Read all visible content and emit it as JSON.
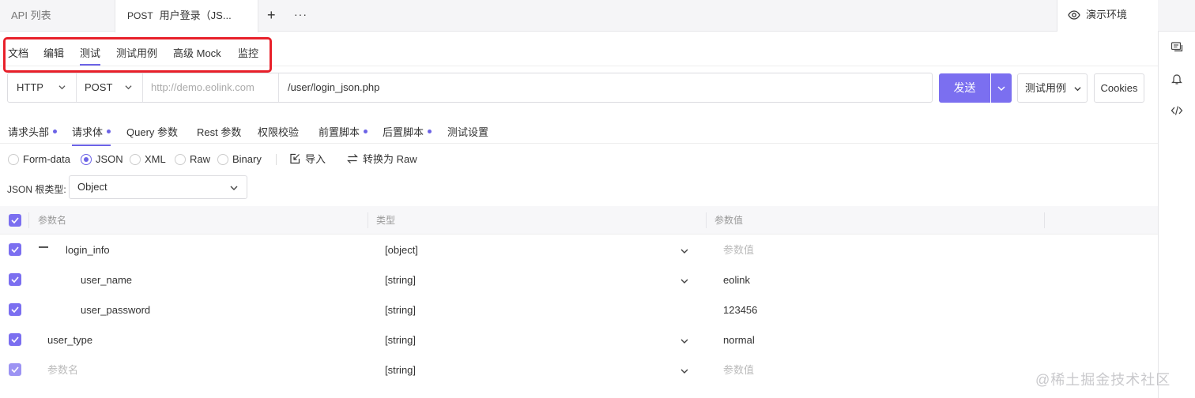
{
  "tabs": {
    "api_list": "API 列表",
    "current_method": "POST",
    "current_title": "用户登录（JS...",
    "add": "+",
    "more": "···"
  },
  "environment": {
    "label": "演示环境"
  },
  "sub_tabs": [
    "文档",
    "编辑",
    "测试",
    "测试用例",
    "高级 Mock",
    "监控"
  ],
  "url_bar": {
    "protocol": "HTTP",
    "method": "POST",
    "host_placeholder": "http://demo.eolink.com",
    "path": "/user/login_json.php"
  },
  "actions": {
    "send": "发送",
    "test_case": "测试用例",
    "cookies": "Cookies"
  },
  "request_tabs": [
    {
      "label": "请求头部",
      "dot": true
    },
    {
      "label": "请求体",
      "dot": true
    },
    {
      "label": "Query 参数",
      "dot": false
    },
    {
      "label": "Rest 参数",
      "dot": false
    },
    {
      "label": "权限校验",
      "dot": false
    },
    {
      "label": "前置脚本",
      "dot": true
    },
    {
      "label": "后置脚本",
      "dot": true
    },
    {
      "label": "测试设置",
      "dot": false
    }
  ],
  "body_formats": {
    "options": [
      "Form-data",
      "JSON",
      "XML",
      "Raw",
      "Binary"
    ],
    "selected": "JSON",
    "import": "导入",
    "convert": "转换为 Raw"
  },
  "json_root": {
    "label": "JSON 根类型:",
    "value": "Object"
  },
  "table": {
    "headers": {
      "name": "参数名",
      "type": "类型",
      "value": "参数值"
    },
    "rows": [
      {
        "name": "login_info",
        "type": "[object]",
        "value": "参数值",
        "value_placeholder": true,
        "level": 0,
        "collapsible": true,
        "dropdown": true
      },
      {
        "name": "user_name",
        "type": "[string]",
        "value": "eolink",
        "value_placeholder": false,
        "level": 2,
        "collapsible": false,
        "dropdown": true
      },
      {
        "name": "user_password",
        "type": "[string]",
        "value": "123456",
        "value_placeholder": false,
        "level": 2,
        "collapsible": false,
        "dropdown": false
      },
      {
        "name": "user_type",
        "type": "[string]",
        "value": "normal",
        "value_placeholder": false,
        "level": 1,
        "collapsible": false,
        "dropdown": true
      },
      {
        "name": "参数名",
        "name_placeholder": true,
        "type": "[string]",
        "value": "参数值",
        "value_placeholder": true,
        "level": 1,
        "collapsible": false,
        "dropdown": true
      }
    ]
  },
  "watermark": "@稀土掘金技术社区",
  "colors": {
    "accent": "#7b6ff0",
    "highlight_box": "#e8202a"
  }
}
